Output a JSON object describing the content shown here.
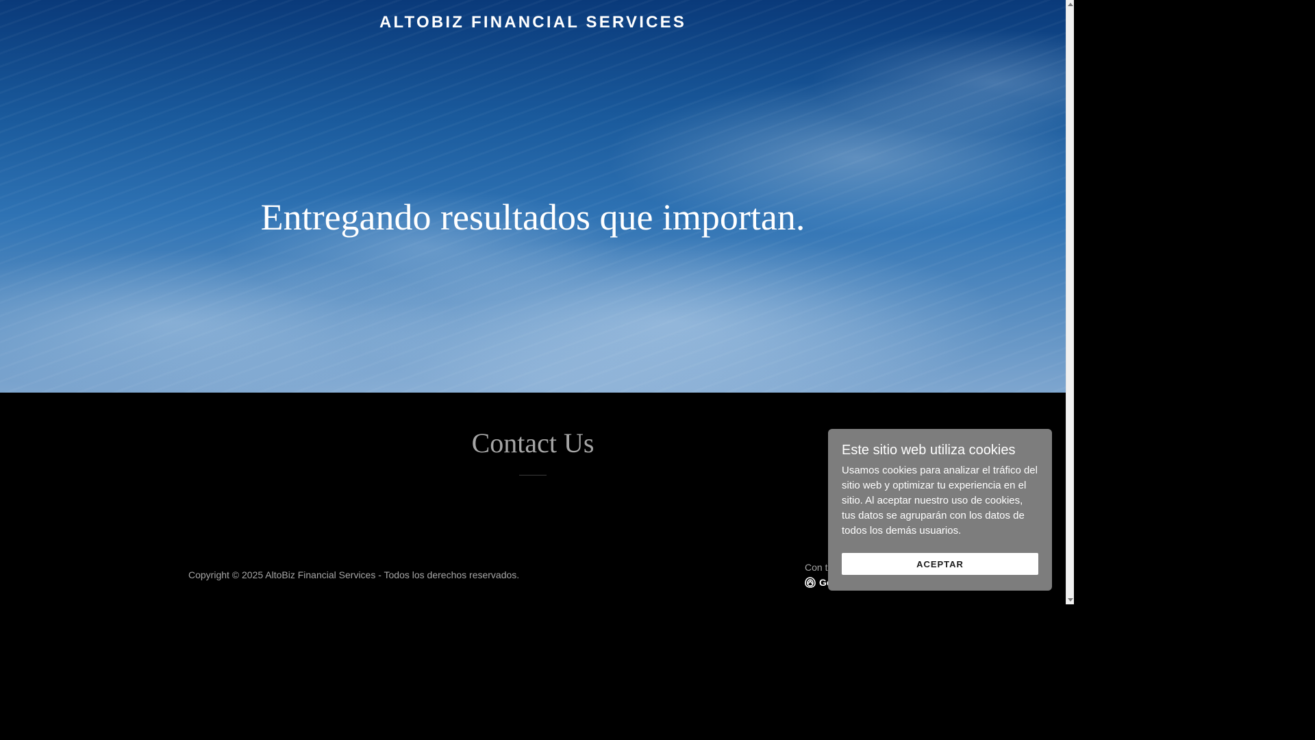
{
  "header": {
    "site_title": "ALTOBIZ FINANCIAL SERVICES"
  },
  "hero": {
    "headline": "Entregando resultados que importan."
  },
  "contact": {
    "heading": "Contact Us"
  },
  "footer": {
    "copyright": "Copyright © 2025 AltoBiz Financial Services - Todos los derechos reservados.",
    "powered_by_partial": "Con te",
    "logo_partial": "Go"
  },
  "cookie_banner": {
    "title": "Este sitio web utiliza cookies",
    "body": "Usamos cookies para analizar el tráfico del sitio web y optimizar tu experiencia en el sitio. Al aceptar nuestro uso de cookies, tus datos se agruparán con los datos de todos los demás usuarios.",
    "accept_label": "ACEPTAR"
  },
  "colors": {
    "cookie_bg": "#7d7d7d",
    "footer_bg": "#000000",
    "muted_text": "#a6a6a6"
  }
}
